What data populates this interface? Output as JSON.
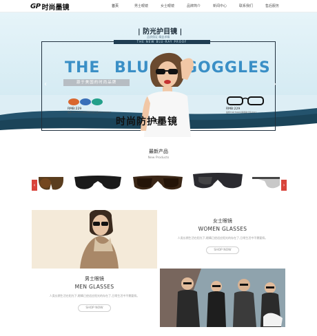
{
  "header": {
    "logo_mark": "GP",
    "logo_text": "时尚墨镜",
    "nav": [
      "首页",
      "男士眼镜",
      "女士眼镜",
      "品牌简介",
      "新闻中心",
      "联系我们",
      "售后服务"
    ]
  },
  "banner": {
    "title": "防光护目镜",
    "title_left_bracket": "|",
    "title_right_bracket": "|",
    "subtitle": "品质保证 精益求精",
    "tag": "THE NEW BLU-RAY PROOF",
    "headline_left": "THE",
    "headline_mid": "BLU",
    "headline_right": "GOGGLES",
    "strip_text": "源于美国的时尚品牌",
    "price_left_label": "RMB:229",
    "price_left_note": "品牌/TOM FORD时尚太阳镜/全新正品/BLU-RAY/2017",
    "price_right_label": "RMB:229",
    "price_right_note": "品牌/TOM FORD时尚眼镜/全新/2017",
    "big_cn": "时尚防护墨镜",
    "arrow_left": "‹",
    "arrow_right": "›"
  },
  "products": {
    "title": "最新产品",
    "subtitle": "New Products",
    "arrow_left": "‹",
    "arrow_right": "›"
  },
  "women": {
    "title_cn": "女士眼镜",
    "title_en": "WOMEN GLASSES",
    "desc": "人类长期生活在阳光下,眼睛已经适应阳光的存在了,日常生活中不需要佩。",
    "button": "SHOP NOW"
  },
  "men": {
    "title_cn": "男士眼镜",
    "title_en": "MEN GLASSES",
    "desc": "人类长期生活在阳光下,眼睛已经适应阳光的存在了,日常生活中不需要佩。",
    "button": "SHOP NOW"
  },
  "colors": {
    "accent_blue": "#3a8fc6",
    "dark_navy": "#1f3d52",
    "arrow_red": "#d9443b"
  },
  "icons": {
    "prev_arrow": "chevron-left-icon",
    "next_arrow": "chevron-right-icon"
  }
}
